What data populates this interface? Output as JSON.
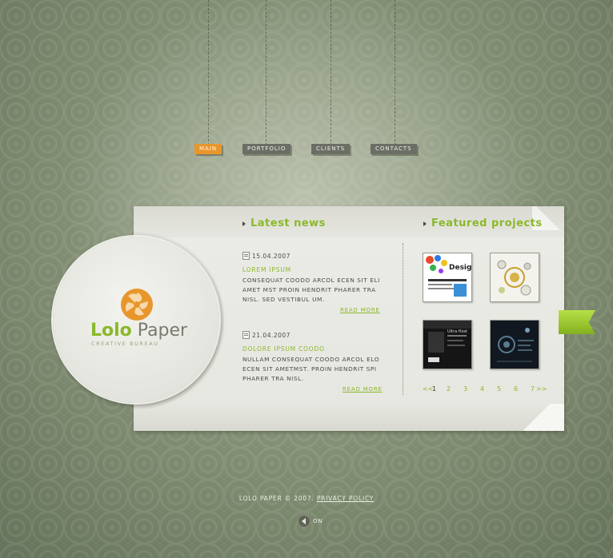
{
  "nav": {
    "items": [
      {
        "label": "MAIN",
        "active": true
      },
      {
        "label": "PORTFOLIO",
        "active": false
      },
      {
        "label": "CLIENTS",
        "active": false
      },
      {
        "label": "CONTACTS",
        "active": false
      }
    ]
  },
  "logo": {
    "name_part1": "Lolo",
    "name_part2": "Paper",
    "tagline": "CREATIVE BUREAU"
  },
  "news": {
    "heading": "Latest news",
    "items": [
      {
        "date": "15.04.2007",
        "title": "LOREM IPSUM",
        "text": "CONSEQUAT COODO ARCOL ECEN SIT ELI AMET MST PROIN HENDRIT PHARER TRA NISL. SED VESTIBUL UM.",
        "read_more": "READ MORE"
      },
      {
        "date": "21.04.2007",
        "title": "DOLORE IPSUM COODO",
        "text": "NULLAM CONSEQUAT COODO ARCOL ELO ECEN SIT AMETMST. PROIN HENDRIT SPI PHARER TRA NISL.",
        "read_more": "READ MORE"
      }
    ]
  },
  "projects": {
    "heading": "Featured projects",
    "thumbs": [
      {
        "label": "Design"
      },
      {
        "label": ""
      },
      {
        "label": "Ultra Host"
      },
      {
        "label": ""
      }
    ],
    "pager": {
      "prev": "<<",
      "pages": [
        "1",
        "2",
        "3",
        "4",
        "5",
        "6",
        "7"
      ],
      "current": "1",
      "next": ">>"
    }
  },
  "footer": {
    "copyright": "LOLO PAPER © 2007.",
    "privacy_link": "PRIVACY POLICY"
  },
  "sound": {
    "label": "ON"
  },
  "colors": {
    "accent_green": "#8ab82a",
    "accent_orange": "#e8962c",
    "paper": "#e7e7e1"
  }
}
